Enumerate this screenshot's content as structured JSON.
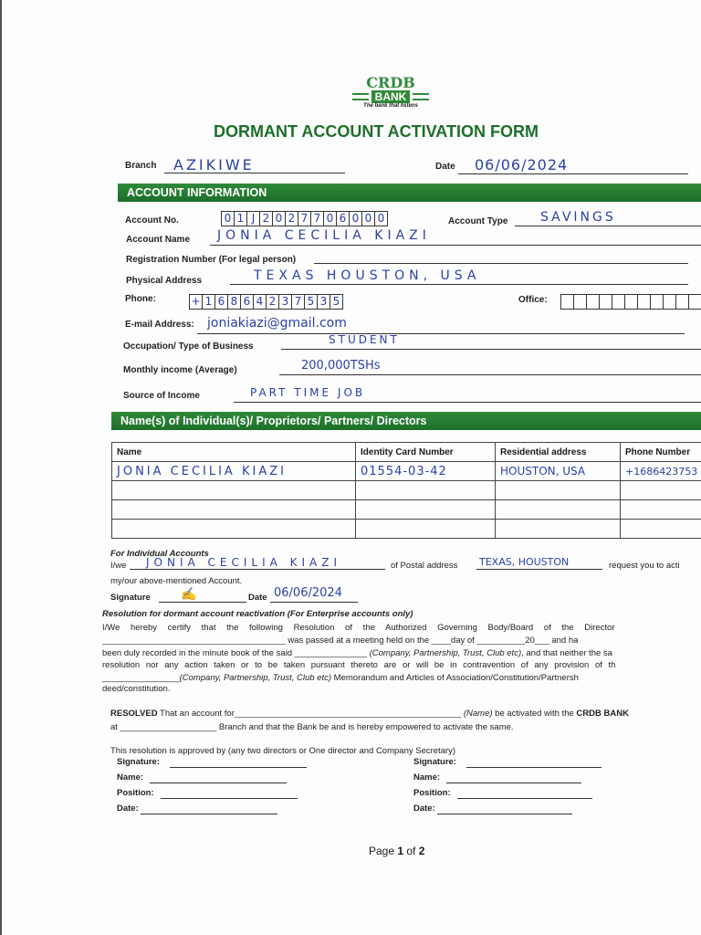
{
  "logo": {
    "brand": "CRDB",
    "bank": "BANK",
    "tagline": "The bank that listens"
  },
  "title": "DORMANT ACCOUNT ACTIVATION FORM",
  "branch": {
    "label": "Branch",
    "value": "AZIKIWE"
  },
  "date": {
    "label": "Date",
    "value": "06/06/2024"
  },
  "section1": "ACCOUNT INFORMATION",
  "account_no": {
    "label": "Account No.",
    "digits": [
      "0",
      "1",
      "J",
      "2",
      "0",
      "2",
      "7",
      "7",
      "0",
      "6",
      "0",
      "0",
      "0"
    ]
  },
  "account_type": {
    "label": "Account Type",
    "value": "SAVINGS"
  },
  "account_name": {
    "label": "Account Name",
    "value": "JONIA CECILIA KIAZI"
  },
  "registration": {
    "label": "Registration Number (For legal person)"
  },
  "address": {
    "label": "Physical Address",
    "value": "TEXAS HOUSTON, USA"
  },
  "phone": {
    "label": "Phone:",
    "digits": [
      "+",
      "1",
      "6",
      "8",
      "6",
      "4",
      "2",
      "3",
      "7",
      "5",
      "3",
      "5"
    ]
  },
  "office": {
    "label": "Office:"
  },
  "email": {
    "label": "E-mail Address:",
    "value": "joniakiazi@gmail.com"
  },
  "occupation": {
    "label": "Occupation/ Type of Business",
    "value": "STUDENT"
  },
  "income": {
    "label": "Monthly income (Average)",
    "value": "200,000TSHs"
  },
  "source": {
    "label": "Source of Income",
    "value": "PART TIME JOB"
  },
  "section2": "Name(s) of Individual(s)/ Proprietors/ Partners/ Directors",
  "table": {
    "headers": [
      "Name",
      "Identity Card Number",
      "Residential address",
      "Phone Number"
    ],
    "rows": [
      [
        "JONIA CECILIA KIAZI",
        "01554-03-42",
        "HOUSTON, USA",
        "+1686423753"
      ]
    ]
  },
  "individual": {
    "heading": "For Individual Accounts",
    "iwe": "I/we",
    "name": "JONIA CECILIA KIAZI",
    "postal": "of Postal address",
    "postal_value": "TEXAS, HOUSTON",
    "request": "request you to acti",
    "line2": "my/our above-mentioned Account.",
    "sig_label": "Signature",
    "date_label": "Date",
    "date_value": "06/06/2024"
  },
  "resolution": {
    "heading": "Resolution for dormant account reactivation (For Enterprise accounts only)",
    "l1": "I/We hereby certify that the following Resolution of the Authorized Governing Body/Board of the Director",
    "l2": "______________________________________ was passed at a meeting held on the ____day of __________20___ and ha",
    "l3a": "been duly recorded in the minute book of the said _______________ ",
    "l3b": "(Company, Partnership, Trust, Club etc)",
    "l3c": ", and that neither the sa",
    "l4": "resolution nor any action taken or to be taken pursuant thereto are or will be in contravention of any provision of th",
    "l5a": "________________",
    "l5b": "(Company, Partnership, Trust, Club etc)",
    "l5c": " Memorandum and Articles of Association/Constitution/Partnersh",
    "l6": "deed/constitution."
  },
  "resolved": {
    "bold": "RESOLVED",
    "t1": " That an account for_______________________________________________ ",
    "name": "(Name)",
    "t2": " be activated with the ",
    "bank": "CRDB BANK",
    "l2": "at ____________________ Branch and that the Bank be and is hereby empowered to activate the same."
  },
  "approval": {
    "intro": "This resolution is approved by (any two directors or One director and Company Secretary)",
    "fields": [
      "Signature:",
      "Name:",
      "Position:",
      "Date:"
    ]
  },
  "footer": {
    "pre": "Page ",
    "cur": "1",
    "mid": " of ",
    "total": "2"
  }
}
